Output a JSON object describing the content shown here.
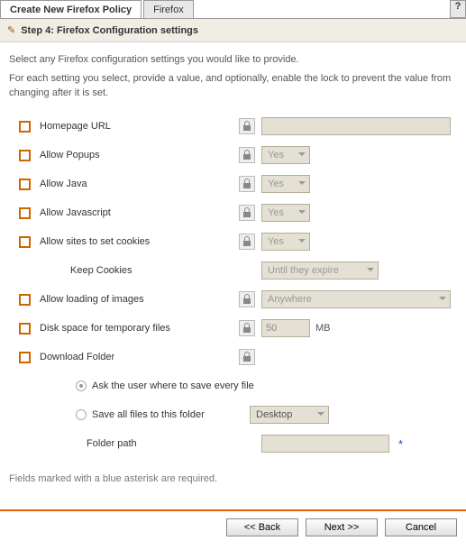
{
  "tabs": {
    "active": "Create New Firefox Policy",
    "other": "Firefox",
    "help": "?"
  },
  "step": {
    "title": "Step 4: Firefox Configuration settings"
  },
  "intro1": "Select any Firefox configuration settings you would like to provide.",
  "intro2": "For each setting you select, provide a value, and optionally, enable the lock to prevent the value from changing after it is set.",
  "settings": {
    "homepage": {
      "label": "Homepage URL",
      "value": ""
    },
    "popups": {
      "label": "Allow Popups",
      "value": "Yes"
    },
    "java": {
      "label": "Allow Java",
      "value": "Yes"
    },
    "javascript": {
      "label": "Allow Javascript",
      "value": "Yes"
    },
    "cookies": {
      "label": "Allow sites to set cookies",
      "value": "Yes"
    },
    "keep_cookies": {
      "label": "Keep Cookies",
      "value": "Until they expire"
    },
    "images": {
      "label": "Allow loading of images",
      "value": "Anywhere"
    },
    "disk": {
      "label": "Disk space for temporary files",
      "value": "50",
      "unit": "MB"
    },
    "download": {
      "label": "Download Folder"
    },
    "radio_ask": "Ask the user where to save every file",
    "radio_save": "Save all files to this folder",
    "save_location": "Desktop",
    "folder_path": {
      "label": "Folder path",
      "value": ""
    }
  },
  "note": "Fields marked with a blue asterisk are required.",
  "buttons": {
    "back": "<< Back",
    "next": "Next >>",
    "cancel": "Cancel"
  }
}
